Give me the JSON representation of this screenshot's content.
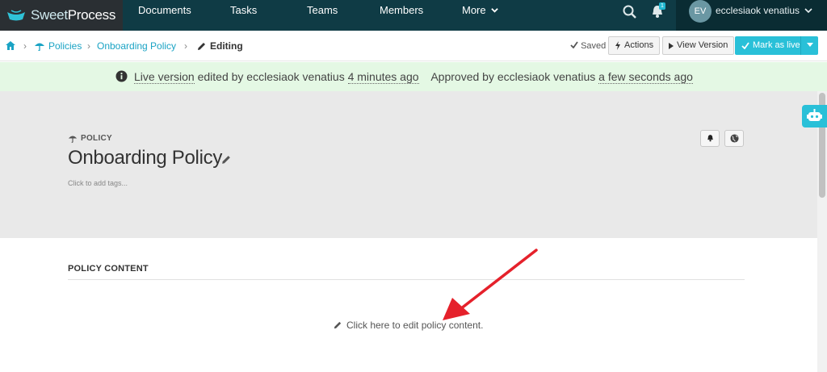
{
  "brand": {
    "name_part1": "Sweet",
    "name_part2": "Process"
  },
  "nav": {
    "items": [
      {
        "label": "Documents"
      },
      {
        "label": "Tasks"
      },
      {
        "label": "Teams"
      },
      {
        "label": "Members"
      },
      {
        "label": "More"
      }
    ],
    "notifications_count": "1"
  },
  "user": {
    "initials": "EV",
    "name": "ecclesiaok venatius"
  },
  "breadcrumb": {
    "policies": "Policies",
    "policy": "Onboarding Policy",
    "current": "Editing"
  },
  "toolbar": {
    "saved": "Saved",
    "actions": "Actions",
    "view_version": "View Version",
    "mark_as_live": "Mark as live"
  },
  "banner": {
    "live_version": "Live version",
    "edited_by": "edited by ecclesiaok venatius",
    "edited_time": "4 minutes ago",
    "approved_by": "Approved by ecclesiaok venatius",
    "approved_time": "a few seconds ago"
  },
  "policy": {
    "kicker": "POLICY",
    "title": "Onboarding Policy",
    "tags_hint": "Click to add tags..."
  },
  "content": {
    "section_label": "POLICY CONTENT",
    "edit_hint": "Click here to edit policy content."
  },
  "colors": {
    "navbar": "#0f3b45",
    "accent": "#29c0d8",
    "link": "#1aa3c4",
    "banner_bg": "#e4f8e4",
    "annotation_arrow": "#e5212b"
  },
  "icons": [
    "home-icon",
    "umbrella-icon",
    "pencil-icon",
    "search-icon",
    "bell-icon",
    "check-icon",
    "bolt-icon",
    "play-icon",
    "info-icon",
    "globe-icon",
    "robot-icon",
    "chevron-down-icon"
  ]
}
